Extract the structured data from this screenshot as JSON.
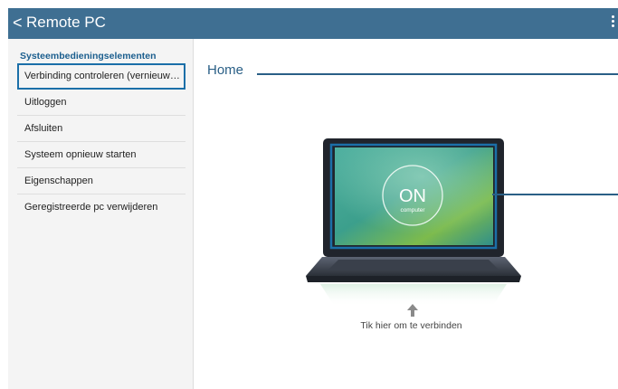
{
  "appbar": {
    "back_glyph": "<",
    "title": "Remote PC",
    "overflow_icon": "vertical-dots-icon",
    "color": "#3f6f92"
  },
  "sidebar": {
    "section_title": "Systeembedieningselementen",
    "items": [
      {
        "label": "Verbinding controleren (vernieuwe..."
      },
      {
        "label": "Uitloggen"
      },
      {
        "label": "Afsluiten"
      },
      {
        "label": "Systeem opnieuw starten"
      },
      {
        "label": "Eigenschappen"
      },
      {
        "label": "Geregistreerde pc verwijderen"
      }
    ]
  },
  "main": {
    "home_label": "Home",
    "laptop": {
      "on_text": "ON",
      "computer_text": "computer"
    },
    "connect_text": "Tik hier om te verbinden"
  },
  "colors": {
    "accent": "#1b6fa8",
    "callout": "#2a5f86"
  }
}
